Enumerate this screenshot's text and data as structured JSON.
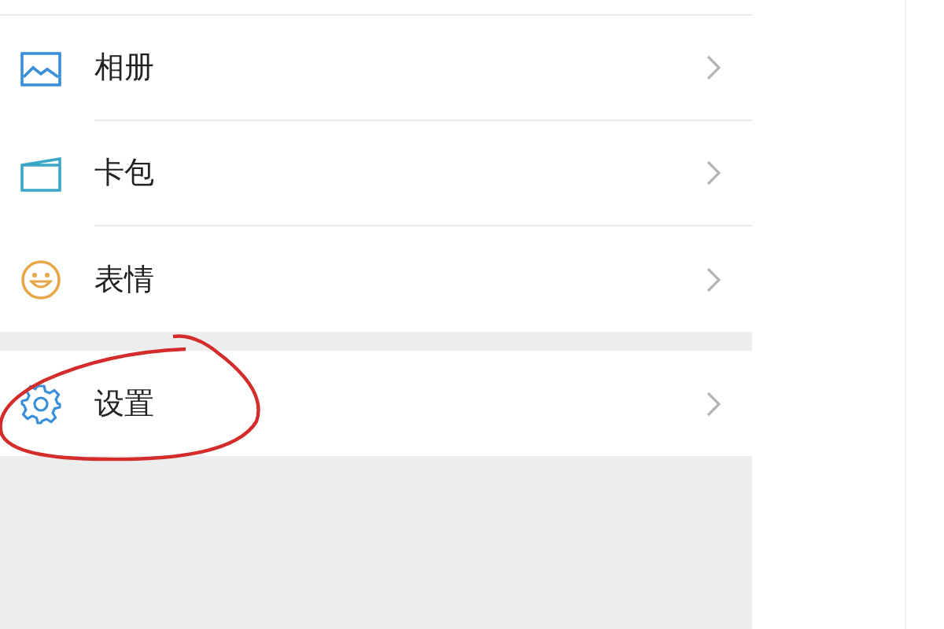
{
  "menu_groups": [
    {
      "items": [
        {
          "label": "相册",
          "kind": "album"
        },
        {
          "label": "卡包",
          "kind": "card"
        },
        {
          "label": "表情",
          "kind": "emoji"
        }
      ]
    },
    {
      "items": [
        {
          "label": "设置",
          "kind": "settings"
        }
      ]
    }
  ],
  "annotation": {
    "kind": "circle"
  }
}
